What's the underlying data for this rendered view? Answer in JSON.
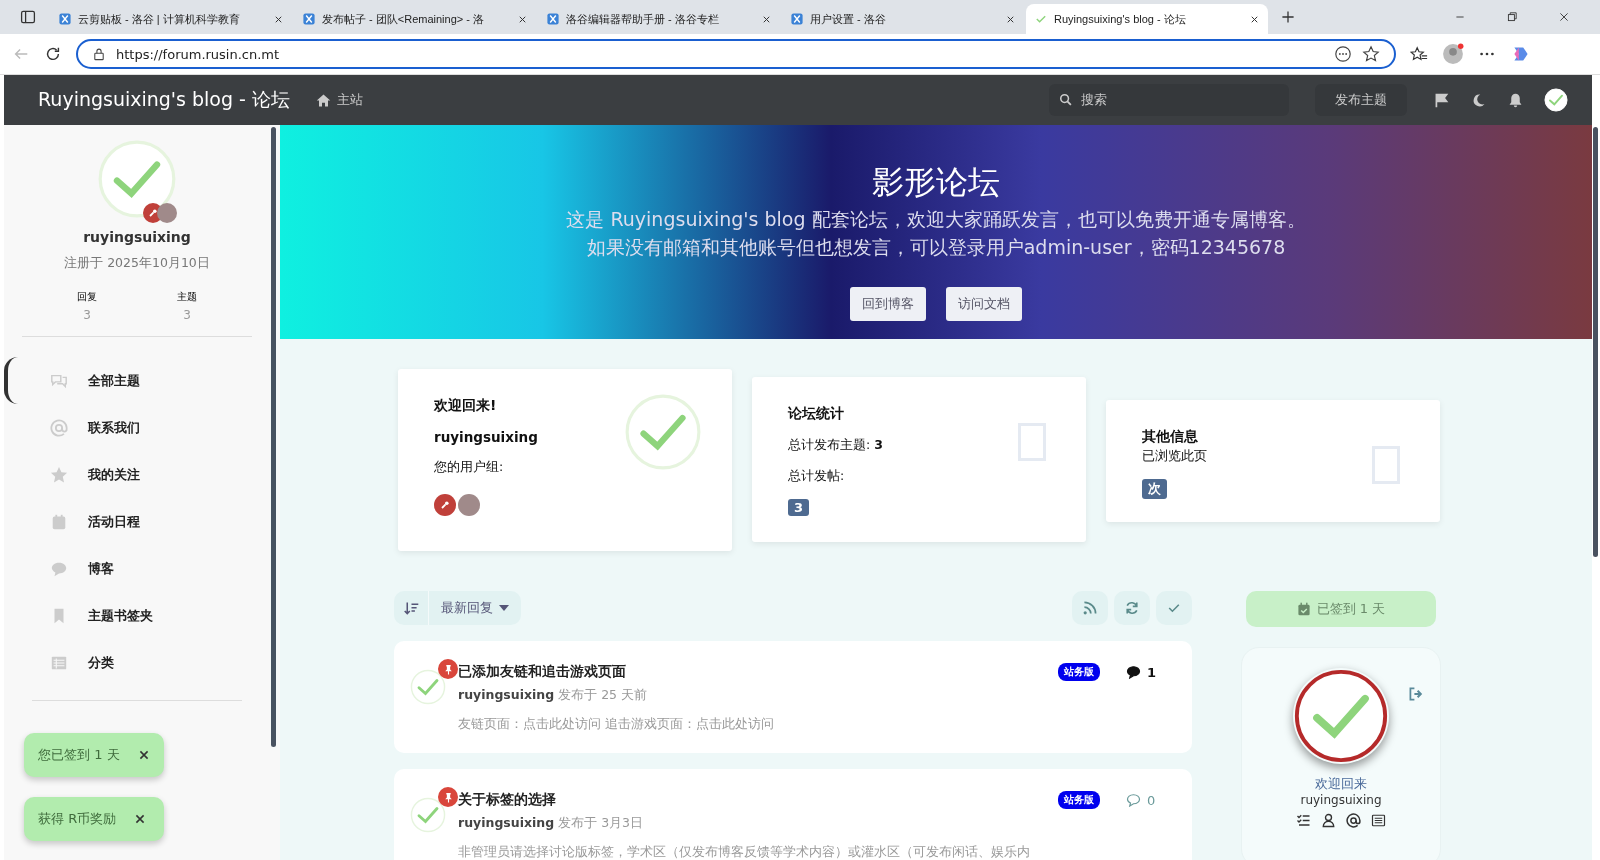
{
  "browser": {
    "tabs": [
      {
        "title": "云剪贴板 - 洛谷 | 计算机科学教育",
        "selected": false
      },
      {
        "title": "发布帖子 - 团队<Remaining> - 洛",
        "selected": false
      },
      {
        "title": "洛谷编辑器帮助手册 - 洛谷专栏",
        "selected": false
      },
      {
        "title": "用户设置 - 洛谷",
        "selected": false
      },
      {
        "title": "Ruyingsuixing's blog - 论坛",
        "selected": true
      }
    ],
    "url": "https://forum.rusin.cn.mt"
  },
  "header": {
    "title": "Ruyingsuixing's blog - 论坛",
    "home": "主站",
    "search_placeholder": "搜索",
    "post_button": "发布主题"
  },
  "sidebar": {
    "username": "ruyingsuixing",
    "registered": "注册于 2025年10月10日",
    "stats": [
      {
        "label": "回复",
        "value": "3"
      },
      {
        "label": "主题",
        "value": "3"
      }
    ],
    "nav": [
      {
        "label": "全部主题",
        "selected": true
      },
      {
        "label": "联系我们",
        "selected": false
      },
      {
        "label": "我的关注",
        "selected": false
      },
      {
        "label": "活动日程",
        "selected": false
      },
      {
        "label": "博客",
        "selected": false
      },
      {
        "label": "主题书签夹",
        "selected": false
      },
      {
        "label": "分类",
        "selected": false
      }
    ]
  },
  "toasts": [
    "您已签到 1 天",
    "获得 R币奖励"
  ],
  "hero": {
    "title": "影形论坛",
    "lines": [
      "这是 Ruyingsuixing's blog 配套论坛，欢迎大家踊跃发言，也可以免费开通专属博客。",
      "如果没有邮箱和其他账号但也想发言，可以登录用户admin-user，密码12345678"
    ],
    "buttons": [
      "回到博客",
      "访问文档"
    ]
  },
  "cards": {
    "welcome": {
      "title": "欢迎回来!",
      "username": "ruyingsuixing",
      "group_label": "您的用户组:"
    },
    "stats": {
      "title": "论坛统计",
      "topics_label": "总计发布主题:",
      "topics_value": "3",
      "posts_label": "总计发帖:",
      "posts_badge": "3"
    },
    "other": {
      "title": "其他信息",
      "text": "已浏览此页",
      "badge": "次"
    }
  },
  "toolbar": {
    "sort": "最新回复"
  },
  "checkin": "已签到 1 天",
  "discussions": [
    {
      "title": "已添加友链和追击游戏页面",
      "author": "ruyingsuixing",
      "meta": "发布于 25 天前",
      "excerpt": "友链页面：点击此处访问 追击游戏页面：点击此处访问",
      "tag": "站务版",
      "replies": "1",
      "unread": true
    },
    {
      "title": "关于标签的选择",
      "author": "ruyingsuixing",
      "meta": "发布于 3月3日",
      "excerpt": "非管理员请选择讨论版标签，学术区（仅发布博客反馈等学术内容）或灌水区（可发布闲话、娱乐内",
      "tag": "站务版",
      "replies": "0",
      "unread": false
    }
  ],
  "profile": {
    "greeting": "欢迎回来",
    "username": "ruyingsuixing"
  }
}
